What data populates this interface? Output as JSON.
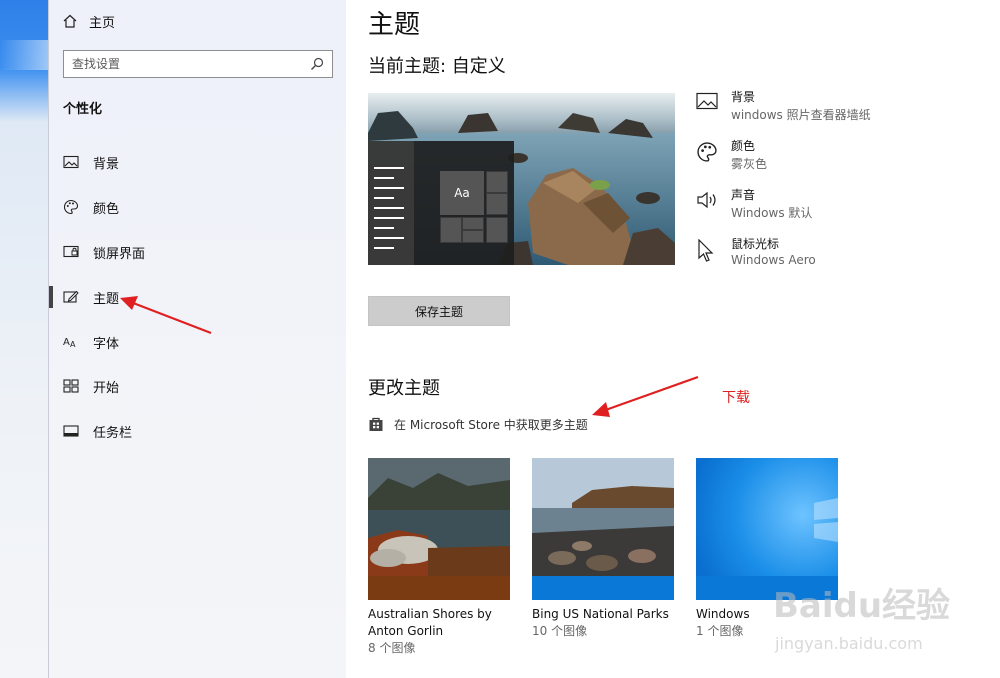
{
  "sidebar": {
    "home_label": "主页",
    "search_placeholder": "查找设置",
    "section_title": "个性化",
    "items": [
      {
        "label": "背景",
        "icon": "picture-icon"
      },
      {
        "label": "颜色",
        "icon": "palette-icon"
      },
      {
        "label": "锁屏界面",
        "icon": "lock-screen-icon"
      },
      {
        "label": "主题",
        "icon": "theme-brush-icon",
        "selected": true
      },
      {
        "label": "字体",
        "icon": "font-icon"
      },
      {
        "label": "开始",
        "icon": "start-grid-icon"
      },
      {
        "label": "任务栏",
        "icon": "taskbar-icon"
      }
    ]
  },
  "main": {
    "page_title": "主题",
    "current_theme": "当前主题: 自定义",
    "preview_tile_text": "Aa",
    "properties": [
      {
        "label": "背景",
        "value": "windows 照片查看器墙纸",
        "icon": "picture-icon"
      },
      {
        "label": "颜色",
        "value": "雾灰色",
        "icon": "palette-icon"
      },
      {
        "label": "声音",
        "value": "Windows 默认",
        "icon": "speaker-icon"
      },
      {
        "label": "鼠标光标",
        "value": "Windows Aero",
        "icon": "cursor-icon"
      }
    ],
    "save_button": "保存主题",
    "change_title": "更改主题",
    "store_link": "在 Microsoft Store 中获取更多主题",
    "themes": [
      {
        "name": "Australian Shores by Anton Gorlin",
        "count": "8 个图像"
      },
      {
        "name": "Bing US National Parks",
        "count": "10 个图像"
      },
      {
        "name": "Windows",
        "count": "1 个图像"
      }
    ]
  },
  "annotation": {
    "text": "下载",
    "color": "#e02020"
  },
  "watermark": {
    "brand": "Baidu经验",
    "url": "jingyan.baidu.com"
  },
  "colors": {
    "accent_blue": "#0a78d7",
    "selected_bar": "#444444",
    "button_gray": "#cccccc"
  }
}
